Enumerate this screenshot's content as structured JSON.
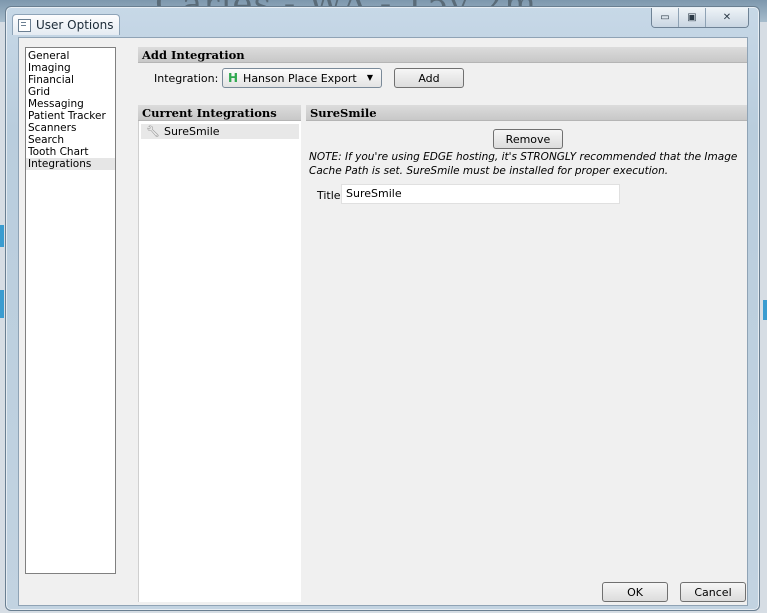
{
  "window": {
    "title": "User Options",
    "caption_buttons": {
      "minimize": "▭",
      "maximize": "▣",
      "close": "✕"
    }
  },
  "background": {
    "partial_title": "Caries - WA - 15y 2m"
  },
  "nav": {
    "items": [
      {
        "label": "General"
      },
      {
        "label": "Imaging"
      },
      {
        "label": "Financial"
      },
      {
        "label": "Grid"
      },
      {
        "label": "Messaging"
      },
      {
        "label": "Patient Tracker"
      },
      {
        "label": "Scanners"
      },
      {
        "label": "Search"
      },
      {
        "label": "Tooth Chart"
      },
      {
        "label": "Integrations",
        "selected": true
      }
    ]
  },
  "add_integration": {
    "header": "Add Integration",
    "integration_label": "Integration:",
    "selected_value": "Hanson Place Export",
    "selected_icon": "H",
    "add_button": "Add"
  },
  "current_integrations": {
    "header": "Current Integrations",
    "items": [
      {
        "label": "SureSmile",
        "icon": "wrench-icon"
      }
    ]
  },
  "detail": {
    "header": "SureSmile",
    "remove_button": "Remove",
    "note": "NOTE:  If you're using EDGE hosting, it's STRONGLY recommended that the Image Cache Path is set.  SureSmile must be installed for proper execution.",
    "title_label": "Title",
    "title_value": "SureSmile"
  },
  "footer": {
    "ok": "OK",
    "cancel": "Cancel"
  },
  "colors": {
    "accent_icon": "#2fa84f",
    "section_bar": "#c8c8c8",
    "selected_row": "#e8e8e8"
  }
}
